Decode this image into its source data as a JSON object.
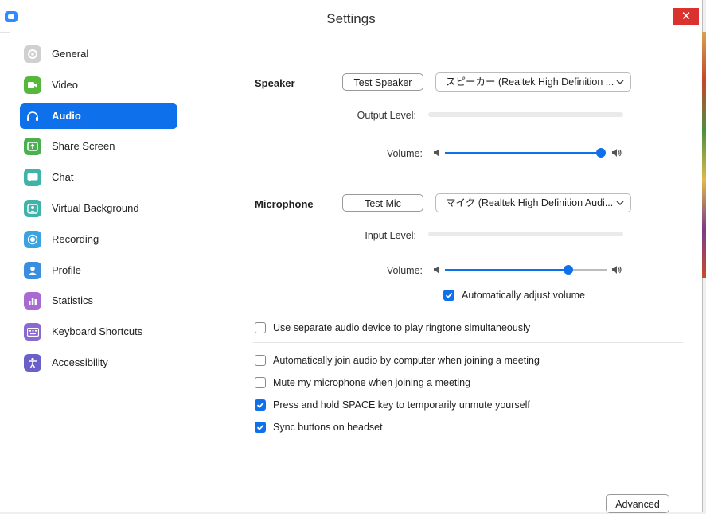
{
  "window": {
    "title": "Settings",
    "close_label": "✕"
  },
  "sidebar": {
    "items": [
      {
        "label": "General",
        "icon": "gear-icon",
        "color": "#d0d0d0",
        "active": false
      },
      {
        "label": "Video",
        "icon": "video-camera-icon",
        "color": "#55b83a",
        "active": false
      },
      {
        "label": "Audio",
        "icon": "headphones-icon",
        "color": "#0e71eb",
        "active": true
      },
      {
        "label": "Share Screen",
        "icon": "share-screen-icon",
        "color": "#4caf50",
        "active": false
      },
      {
        "label": "Chat",
        "icon": "chat-bubble-icon",
        "color": "#3fb2a9",
        "active": false
      },
      {
        "label": "Virtual Background",
        "icon": "virtual-background-icon",
        "color": "#3fb2a9",
        "active": false
      },
      {
        "label": "Recording",
        "icon": "recording-icon",
        "color": "#3aa3e0",
        "active": false
      },
      {
        "label": "Profile",
        "icon": "profile-icon",
        "color": "#3a8ee0",
        "active": false
      },
      {
        "label": "Statistics",
        "icon": "statistics-icon",
        "color": "#a86ad0",
        "active": false
      },
      {
        "label": "Keyboard Shortcuts",
        "icon": "keyboard-icon",
        "color": "#8a6ad0",
        "active": false
      },
      {
        "label": "Accessibility",
        "icon": "accessibility-icon",
        "color": "#6b5fc8",
        "active": false
      }
    ]
  },
  "speaker": {
    "label": "Speaker",
    "test_button": "Test Speaker",
    "device": "スピーカー (Realtek High Definition ...",
    "output_level_label": "Output Level:",
    "volume_label": "Volume:",
    "volume": 1.0
  },
  "microphone": {
    "label": "Microphone",
    "test_button": "Test Mic",
    "device": "マイク (Realtek High Definition Audi...",
    "input_level_label": "Input Level:",
    "volume_label": "Volume:",
    "volume": 0.76,
    "auto_adjust_label": "Automatically adjust volume",
    "auto_adjust": true
  },
  "options": {
    "separate_device": {
      "label": "Use separate audio device to play ringtone simultaneously",
      "checked": false
    },
    "auto_join": {
      "label": "Automatically join audio by computer when joining a meeting",
      "checked": false
    },
    "mute_on_join": {
      "label": "Mute my microphone when joining a meeting",
      "checked": false
    },
    "space_unmute": {
      "label": "Press and hold SPACE key to temporarily unmute yourself",
      "checked": true
    },
    "sync_headset": {
      "label": "Sync buttons on headset",
      "checked": true
    }
  },
  "advanced_button": "Advanced",
  "colors": {
    "accent": "#0e71eb",
    "close": "#d9322f"
  }
}
